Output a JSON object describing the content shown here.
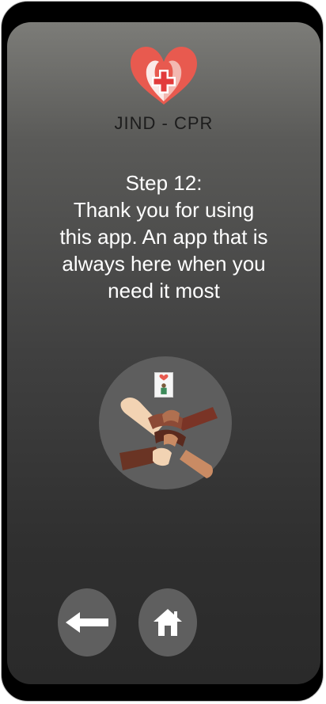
{
  "app": {
    "brand_name": "JIND - CPR",
    "logo_icon": "heart-cross-logo-icon"
  },
  "step": {
    "title": "Step 12:",
    "lines": [
      "Thank you for using",
      "this app. An app that is",
      "always here when you",
      "need it most"
    ]
  },
  "illustration": {
    "icon": "united-hands-icon",
    "mini_card_icon": "app-card-icon"
  },
  "navigation": {
    "back_icon": "arrow-left-icon",
    "home_icon": "home-icon"
  },
  "colors": {
    "heart_red": "#e85a4f",
    "cross_red": "#e23b3b",
    "text_white": "#ffffff",
    "button_gray": "#5f5f5f"
  }
}
